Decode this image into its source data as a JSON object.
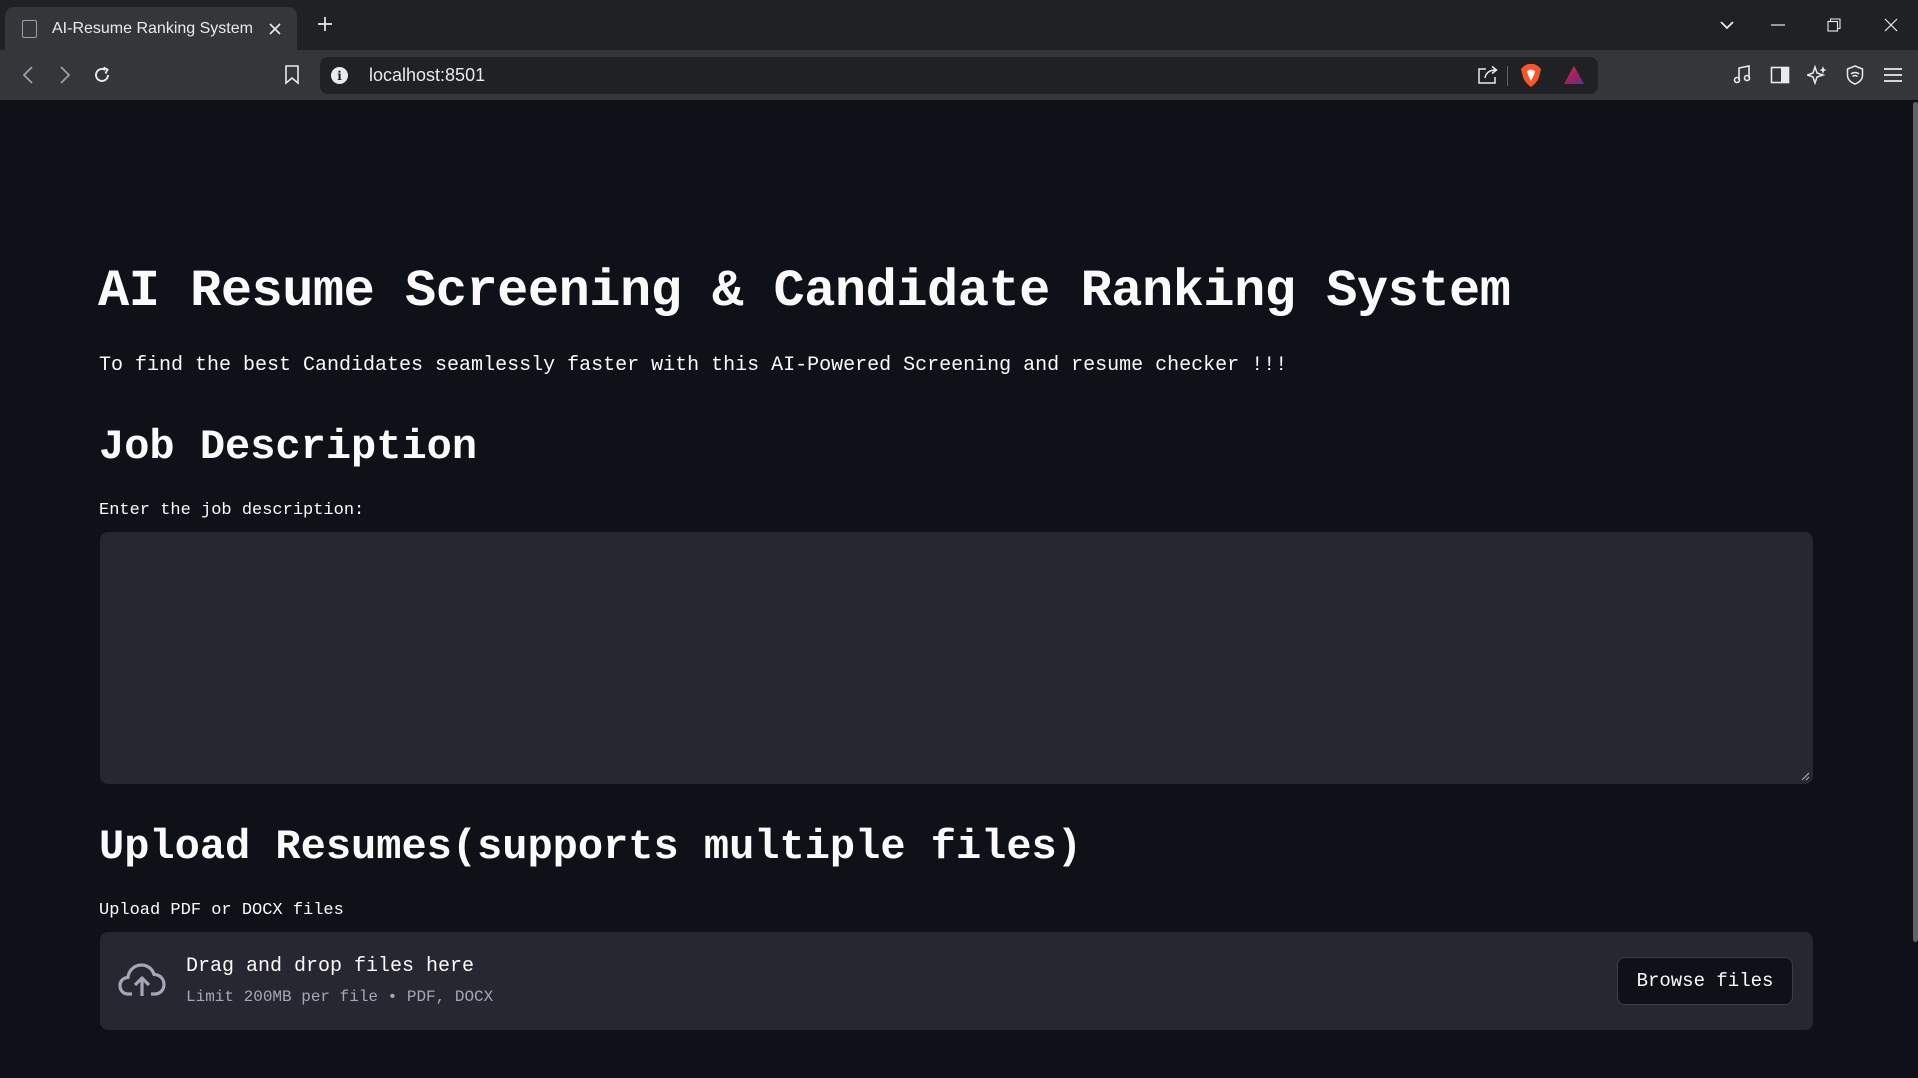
{
  "browser": {
    "tab_title": "AI-Resume Ranking System",
    "url": "localhost:8501"
  },
  "page": {
    "title": "AI Resume Screening & Candidate Ranking System",
    "subtitle": "To find the best Candidates seamlessly faster with this AI-Powered Screening and resume checker !!!",
    "job_section": {
      "heading": "Job Description",
      "input_label": "Enter the job description:",
      "input_value": ""
    },
    "upload_section": {
      "heading": "Upload Resumes(supports multiple files)",
      "input_label": "Upload PDF or DOCX files",
      "dropzone_title": "Drag and drop files here",
      "dropzone_limit": "Limit 200MB per file • PDF, DOCX",
      "browse_label": "Browse files"
    }
  },
  "colors": {
    "background": "#0e1117",
    "input_background": "#262730",
    "text": "#fafafa",
    "muted_text": "#a3a8b8"
  }
}
